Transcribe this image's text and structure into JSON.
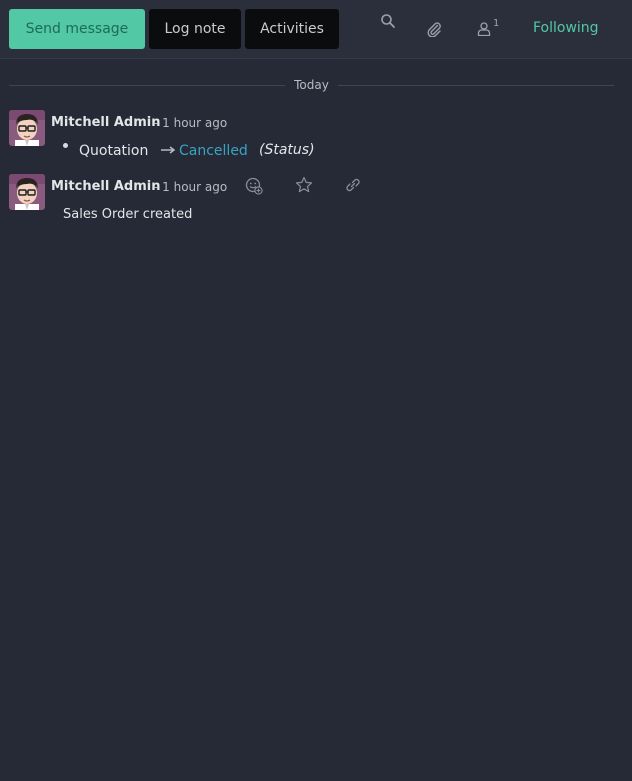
{
  "toolbar": {
    "send_message": "Send message",
    "log_note": "Log note",
    "activities": "Activities",
    "follower_count": "1",
    "following": "Following"
  },
  "thread": {
    "date_separator": "Today",
    "messages": [
      {
        "author": "Mitchell Admin",
        "time": "- 1 hour ago",
        "tracking": {
          "old_value": "Quotation",
          "new_value": "Cancelled",
          "field": "(Status)"
        }
      },
      {
        "author": "Mitchell Admin",
        "time": "- 1 hour ago",
        "body": "Sales Order created"
      }
    ]
  },
  "colors": {
    "accent": "#52c8a4",
    "link": "#3aa3c4",
    "background": "#262a36"
  }
}
